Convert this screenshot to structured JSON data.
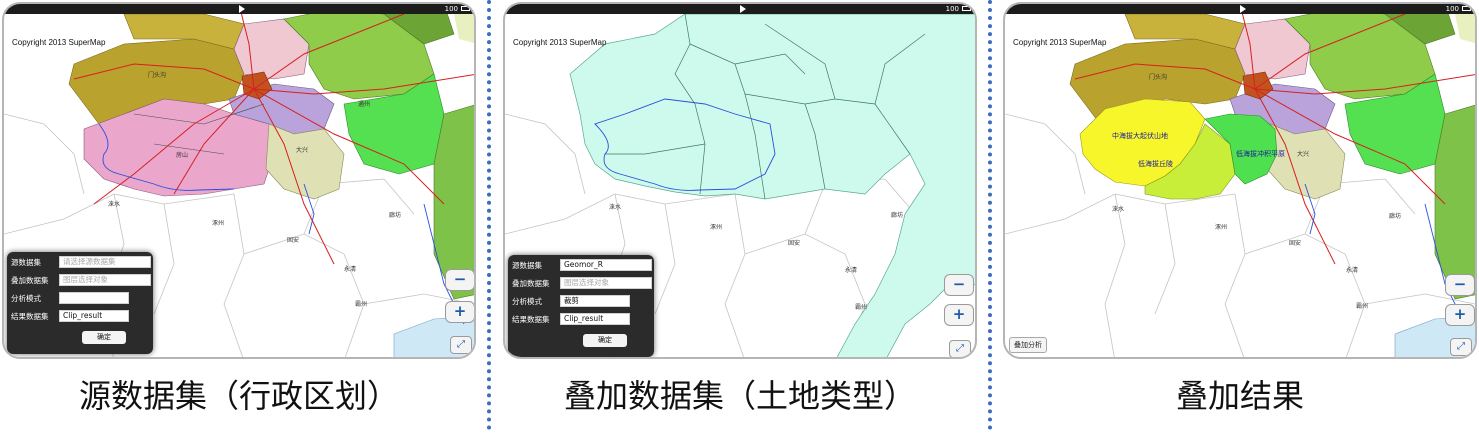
{
  "statusbar": {
    "battery": "100"
  },
  "map": {
    "copyright": "Copyright 2013 SuperMap",
    "zoom_out": "−",
    "zoom_in": "+",
    "fullscreen": "⤢",
    "place_names": {
      "zhuozhou": "涿州",
      "laishui": "涞水",
      "gu_an": "固安",
      "yongqing": "永清",
      "langfang": "廊坊",
      "bazhou": "霸州",
      "fangshan": "房山",
      "daxing": "大兴",
      "tongzhou": "通州",
      "mentougou": "门头沟"
    }
  },
  "source_panel": {
    "form": {
      "source_label": "源数据集",
      "source_placeholder": "请选择源数据集",
      "overlay_label": "叠加数据集",
      "overlay_placeholder": "图层选择对象",
      "mode_label": "分析模式",
      "mode_value": "",
      "result_label": "结果数据集",
      "result_value": "Clip_result",
      "ok_label": "确定"
    },
    "caption": "源数据集（行政区划）"
  },
  "overlay_panel": {
    "form": {
      "source_label": "源数据集",
      "source_value": "Geomor_R",
      "overlay_label": "叠加数据集",
      "overlay_placeholder": "图层选择对象",
      "mode_label": "分析模式",
      "mode_value": "裁剪",
      "result_label": "结果数据集",
      "result_value": "Clip_result",
      "ok_label": "确定"
    },
    "caption": "叠加数据集（土地类型）"
  },
  "result_panel": {
    "region_labels": {
      "mountain": "中海拔大起伏山地",
      "hills": "低海拔丘陵",
      "plain": "低海拔冲积平原"
    },
    "overlay_button": "叠加分析",
    "caption": "叠加结果"
  },
  "colors": {
    "divider": "#3d6cc0",
    "road_red": "#d62020",
    "river_blue": "#2b4ee0",
    "olive": "#b9a22e",
    "pink": "#eba6cc",
    "land_cyan": "#cdfaec",
    "yellow": "#f6f62a",
    "green": "#4fe04f"
  }
}
